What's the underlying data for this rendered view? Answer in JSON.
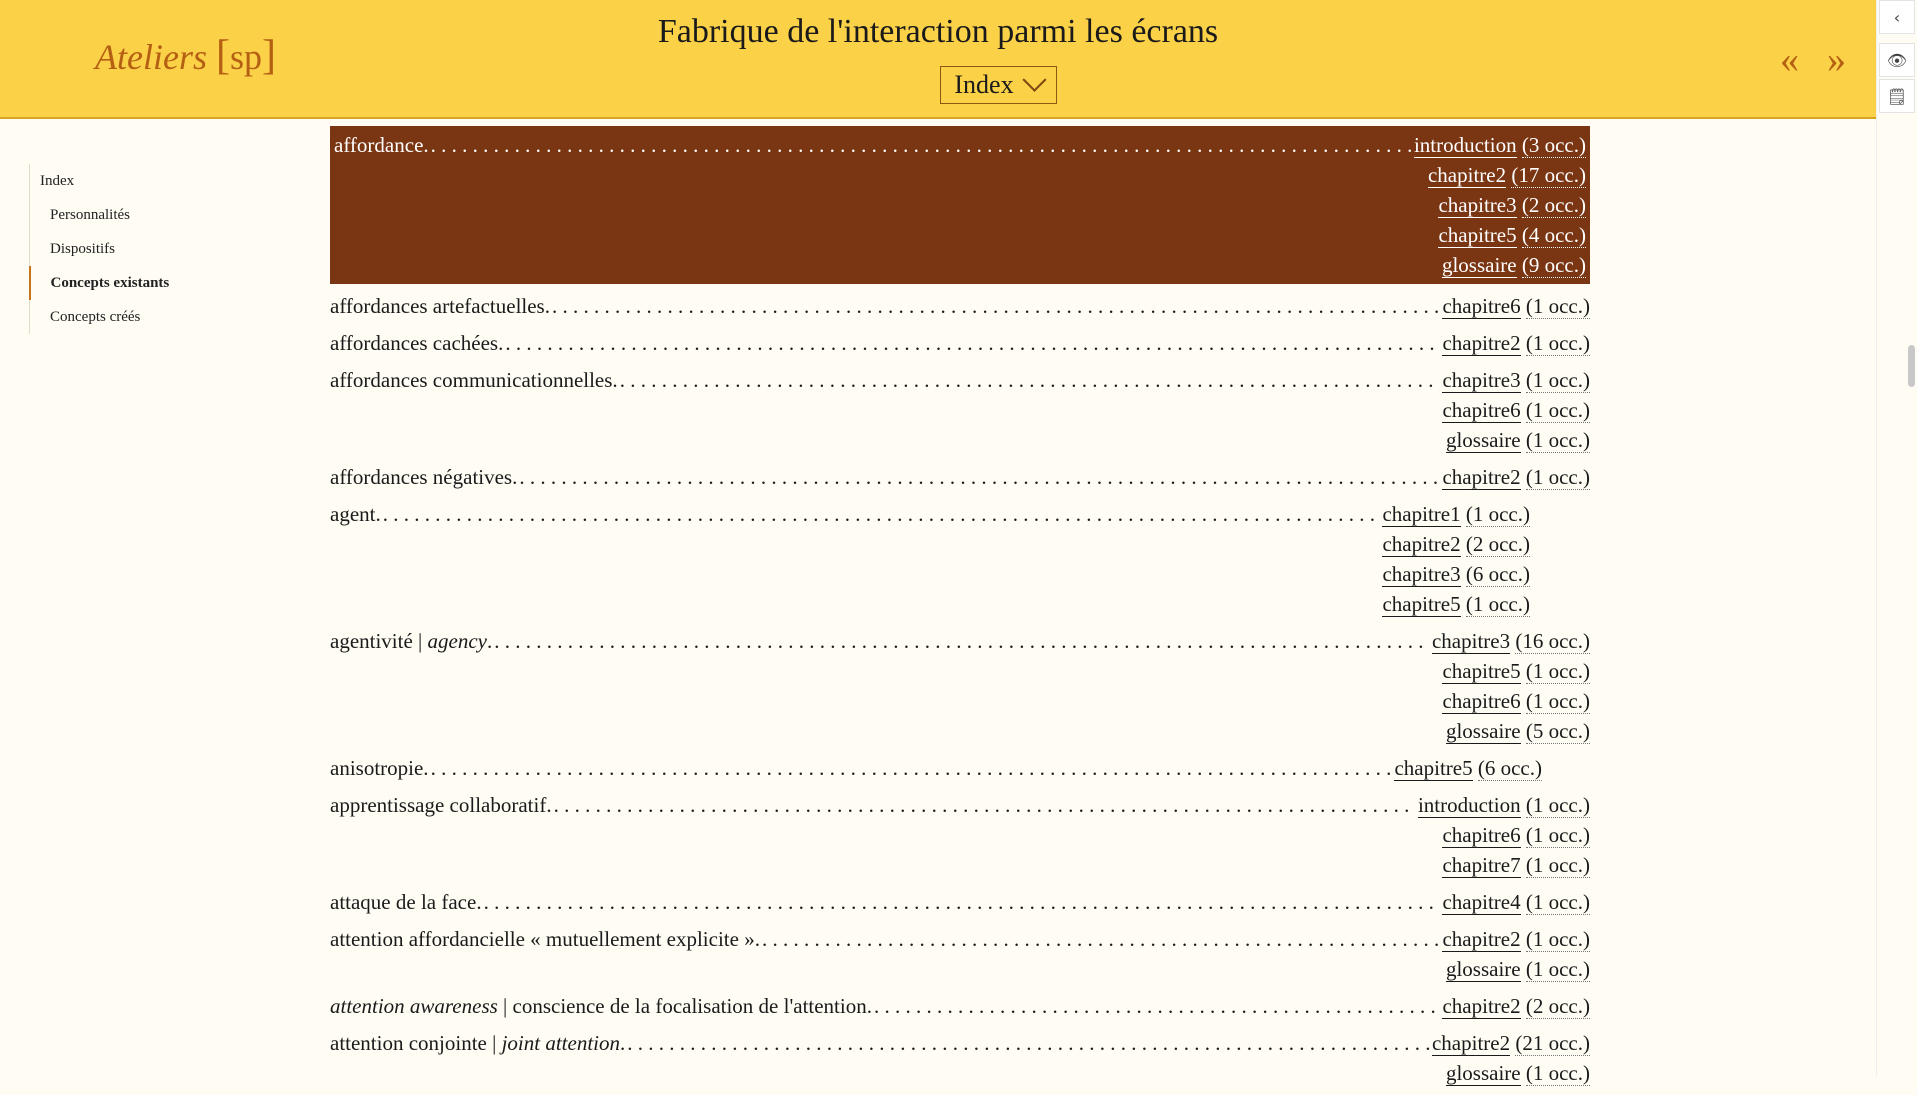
{
  "header": {
    "logo_main": "Ateliers",
    "logo_left_bracket": "[",
    "logo_sp": "sp",
    "logo_right_bracket": "]",
    "title": "Fabrique de l'interaction parmi les écrans",
    "select_value": "Index",
    "prev_label": "«",
    "next_label": "»"
  },
  "rail": {
    "collapse": "‹",
    "view": "👁",
    "note": "🗒"
  },
  "sidebar": {
    "items": [
      {
        "label": "Index"
      },
      {
        "label": "Personnalités"
      },
      {
        "label": "Dispositifs"
      },
      {
        "label": "Concepts existants"
      },
      {
        "label": "Concepts créés"
      }
    ]
  },
  "entries": [
    {
      "term": "affordance.",
      "refs": [
        {
          "ch": "introduction",
          "occ": "(3 occ.)"
        },
        {
          "ch": "chapitre2",
          "occ": "(17 occ.)"
        },
        {
          "ch": "chapitre3",
          "occ": "(2 occ.)"
        },
        {
          "ch": "chapitre5",
          "occ": "(4 occ.)"
        },
        {
          "ch": "glossaire",
          "occ": "(9 occ.)"
        }
      ]
    },
    {
      "term": "affordances artefactuelles.",
      "refs": [
        {
          "ch": "chapitre6",
          "occ": "(1 occ.)"
        }
      ]
    },
    {
      "term": "affordances cachées.",
      "refs": [
        {
          "ch": "chapitre2",
          "occ": "(1 occ.)"
        }
      ]
    },
    {
      "term": "affordances communicationnelles.",
      "refs": [
        {
          "ch": "chapitre3",
          "occ": "(1 occ.)"
        },
        {
          "ch": "chapitre6",
          "occ": "(1 occ.)"
        },
        {
          "ch": "glossaire",
          "occ": "(1 occ.)"
        }
      ]
    },
    {
      "term": "affordances négatives.",
      "refs": [
        {
          "ch": "chapitre2",
          "occ": "(1 occ.)"
        }
      ]
    },
    {
      "term": "agent.",
      "refs": [
        {
          "ch": "chapitre1",
          "occ": "(1 occ.)"
        },
        {
          "ch": "chapitre2",
          "occ": "(2 occ.)"
        },
        {
          "ch": "chapitre3",
          "occ": "(6 occ.)"
        },
        {
          "ch": "chapitre5",
          "occ": "(1 occ.)"
        }
      ]
    },
    {
      "term_a": "agentivité | ",
      "term_em": "agency",
      "term_b": ".",
      "refs": [
        {
          "ch": "chapitre3",
          "occ": "(16 occ.)"
        },
        {
          "ch": "chapitre5",
          "occ": "(1 occ.)"
        },
        {
          "ch": "chapitre6",
          "occ": "(1 occ.)"
        },
        {
          "ch": "glossaire",
          "occ": "(5 occ.)"
        }
      ]
    },
    {
      "term": "anisotropie.",
      "refs": [
        {
          "ch": "chapitre5",
          "occ": "(6 occ.)"
        }
      ]
    },
    {
      "term": "apprentissage collaboratif.",
      "refs": [
        {
          "ch": "introduction",
          "occ": "(1 occ.)"
        },
        {
          "ch": "chapitre6",
          "occ": "(1 occ.)"
        },
        {
          "ch": "chapitre7",
          "occ": "(1 occ.)"
        }
      ]
    },
    {
      "term": "attaque de la face.",
      "refs": [
        {
          "ch": "chapitre4",
          "occ": "(1 occ.)"
        }
      ]
    },
    {
      "term": "attention affordancielle « mutuellement explicite ».",
      "refs": [
        {
          "ch": "chapitre2",
          "occ": "(1 occ.)"
        },
        {
          "ch": "glossaire",
          "occ": "(1 occ.)"
        }
      ]
    },
    {
      "term_em0": "attention awareness",
      "term_a": " | conscience de la focalisation de l'attention.",
      "refs": [
        {
          "ch": "chapitre2",
          "occ": "(2 occ.)"
        }
      ]
    },
    {
      "term_a": "attention conjointe | ",
      "term_em": "joint attention",
      "term_b": ".",
      "refs": [
        {
          "ch": "chapitre2",
          "occ": "(21 occ.)"
        },
        {
          "ch": "glossaire",
          "occ": "(1 occ.)"
        }
      ]
    }
  ],
  "colors": {
    "header_bg": "#fbd147",
    "accent": "#b55f13",
    "highlight_bg": "#7a3613",
    "page_bg": "#fefcf3"
  }
}
